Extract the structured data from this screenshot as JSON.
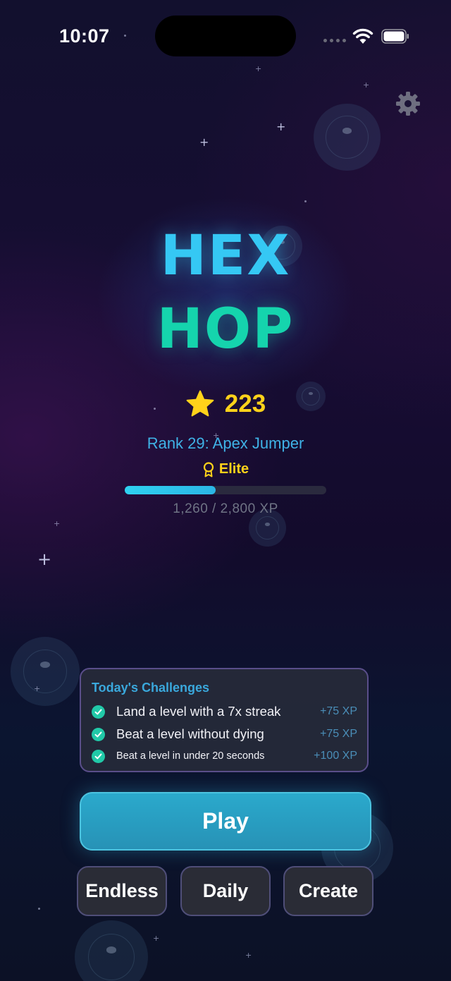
{
  "status_bar": {
    "time": "10:07"
  },
  "settings": {
    "icon": "gear-icon"
  },
  "title": {
    "line1": "HEX",
    "line2": "HOP",
    "colors": {
      "line1": "#35c8f4",
      "line2": "#15d4ad"
    }
  },
  "stars": {
    "icon": "star-icon",
    "count": "223",
    "color": "#ffd21a"
  },
  "rank": {
    "text": "Rank 29: Apex Jumper",
    "tier_icon": "medal-icon",
    "tier": "Elite"
  },
  "xp": {
    "text": "1,260 / 2,800 XP",
    "progress_fraction": 0.45
  },
  "challenges": {
    "title": "Today's Challenges",
    "items": [
      {
        "text": "Land a level with a 7x streak",
        "reward": "+75 XP",
        "completed": true
      },
      {
        "text": "Beat a level without dying",
        "reward": "+75 XP",
        "completed": true
      },
      {
        "text": "Beat a level in under 20 seconds",
        "reward": "+100 XP",
        "completed": true
      }
    ]
  },
  "buttons": {
    "play": "Play",
    "endless": "Endless",
    "daily": "Daily",
    "create": "Create"
  }
}
